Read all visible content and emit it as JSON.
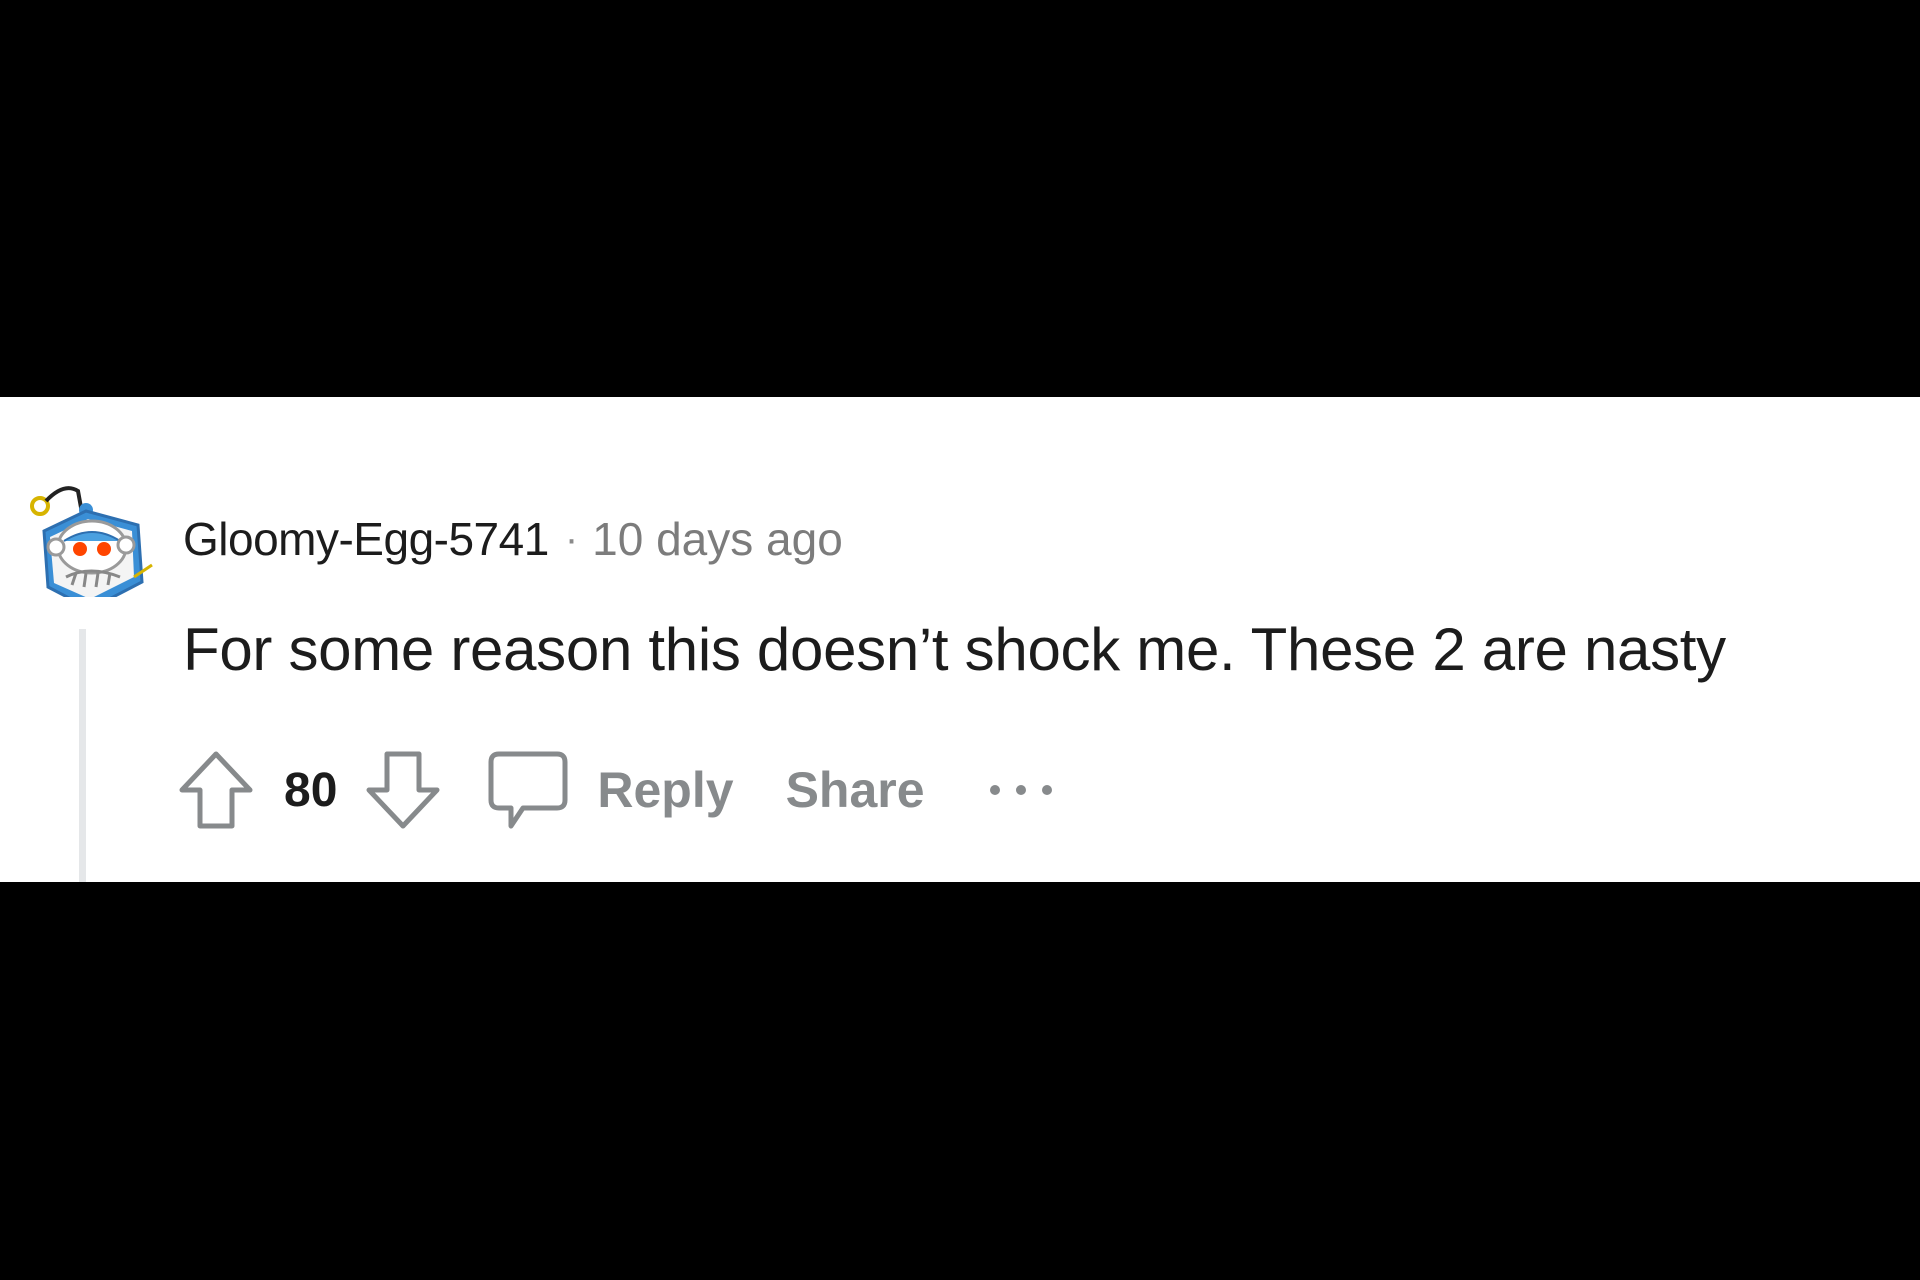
{
  "comment": {
    "author": "Gloomy-Egg-5741",
    "separator": "·",
    "timestamp": "10 days ago",
    "body": "For some reason this doesn’t shock me. These 2 are nasty",
    "score": "80",
    "reply_label": "Reply",
    "share_label": "Share"
  },
  "icons": {
    "avatar": "snoo-avatar",
    "upvote": "arrow-up-icon",
    "downvote": "arrow-down-icon",
    "reply": "speech-bubble-icon",
    "more": "ellipsis-icon"
  },
  "colors": {
    "background_bars": "#000000",
    "card": "#ffffff",
    "text_primary": "#1c1c1c",
    "text_muted": "#878a8c",
    "thread_line": "#e5e7e9",
    "avatar_blue": "#3a8fd6",
    "avatar_orange": "#ff4500"
  }
}
